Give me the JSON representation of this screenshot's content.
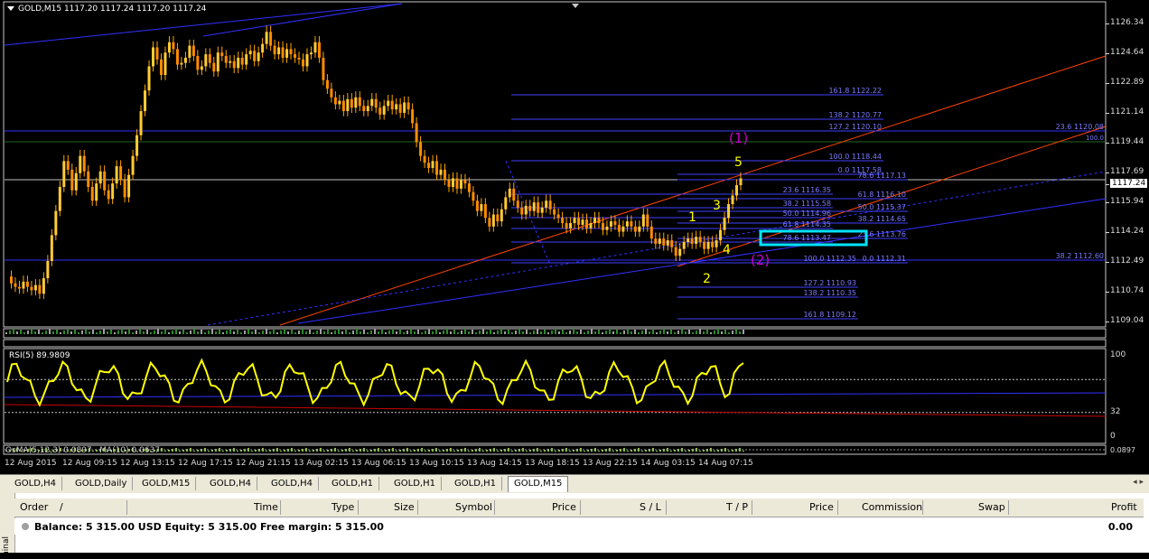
{
  "chart_header": {
    "symbol_info": "GOLD,M15  1117.20 1117.24 1117.20 1117.24"
  },
  "price_axis": {
    "labels": [
      "1126.34",
      "1124.64",
      "1122.89",
      "1121.14",
      "1119.44",
      "1117.69",
      "1117.24",
      "1115.94",
      "1114.24",
      "1112.49",
      "1110.74",
      "1109.04"
    ],
    "current": "1117.24"
  },
  "fib_levels_top": [
    "161.8 1122.22",
    "138.2 1120.77",
    "127.2 1120.10",
    "100.0 1118.44",
    "0.0 1117.58",
    "78.6 1117.13",
    "23.6 1116.35",
    "61.8 1116.10",
    "38.2 1115.58",
    "50.0 1115.37",
    "50.0 1114.96",
    "38.2 1114.65",
    "61.8 1114.35",
    "23.6 1113.76",
    "78.6 1113.47",
    "100.0 1112.35",
    "0.0 1112.31",
    "127.2 1110.93",
    "138.2 1110.35",
    "161.8 1109.12",
    "23.6 1120.08",
    "38.2 1112.60",
    "100.0"
  ],
  "wave_labels": {
    "w1": "1",
    "w2": "2",
    "w3": "3",
    "w4": "4",
    "w5": "5",
    "top": "(1)",
    "bottom": "(2)"
  },
  "rsi": {
    "title": "RSI(5) 89.9809",
    "levels": [
      "100",
      "32",
      "0"
    ]
  },
  "osma": {
    "title": "OsMA(5,12,3) 0.0897 · MA(10) 0.0637",
    "axis": "0.0897"
  },
  "time_axis": [
    "12 Aug 2015",
    "12 Aug 09:15",
    "12 Aug 13:15",
    "12 Aug 17:15",
    "12 Aug 21:15",
    "13 Aug 02:15",
    "13 Aug 06:15",
    "13 Aug 10:15",
    "13 Aug 14:15",
    "13 Aug 18:15",
    "13 Aug 22:15",
    "14 Aug 03:15",
    "14 Aug 07:15"
  ],
  "tabs": [
    "GOLD,H4",
    "GOLD,Daily",
    "GOLD,M15",
    "GOLD,H4",
    "GOLD,H4",
    "GOLD,H1",
    "GOLD,H1",
    "GOLD,H1",
    "GOLD,M15"
  ],
  "active_tab": "GOLD,M15",
  "terminal": {
    "side_label": "minal",
    "columns": [
      "Order",
      "/",
      "Time",
      "Type",
      "Size",
      "Symbol",
      "Price",
      "S / L",
      "T / P",
      "Price",
      "Commission",
      "Swap",
      "Profit"
    ],
    "balance": "Balance: 5 315.00 USD  Equity: 5 315.00  Free margin: 5 315.00",
    "profit": "0.00"
  },
  "colors": {
    "bull": "#ffa500",
    "bear": "#ffa500",
    "rsi": "#ffff00",
    "trend": "#ff4500",
    "fib": "#4040ff",
    "wave": "#ffff00",
    "wave_major": "#cc00cc",
    "highlight": "#00e5ff"
  }
}
